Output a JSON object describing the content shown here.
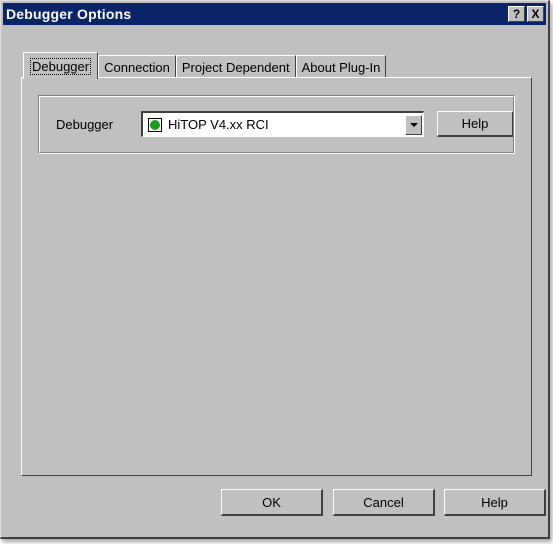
{
  "window": {
    "title": "Debugger Options",
    "help_button": "?",
    "close_button": "X"
  },
  "tabs": [
    {
      "label": "Debugger",
      "active": true
    },
    {
      "label": "Connection",
      "active": false
    },
    {
      "label": "Project Dependent",
      "active": false
    },
    {
      "label": "About Plug-In",
      "active": false
    }
  ],
  "debugger_group": {
    "label": "Debugger",
    "combo_value": "HiTOP V4.xx RCI",
    "combo_icon": "green-circle-icon",
    "help_label": "Help"
  },
  "footer": {
    "ok_label": "OK",
    "cancel_label": "Cancel",
    "help_label": "Help"
  },
  "colors": {
    "titlebar": "#0a246a",
    "face": "#c0c0c0",
    "status_green": "#1e9a1e"
  }
}
